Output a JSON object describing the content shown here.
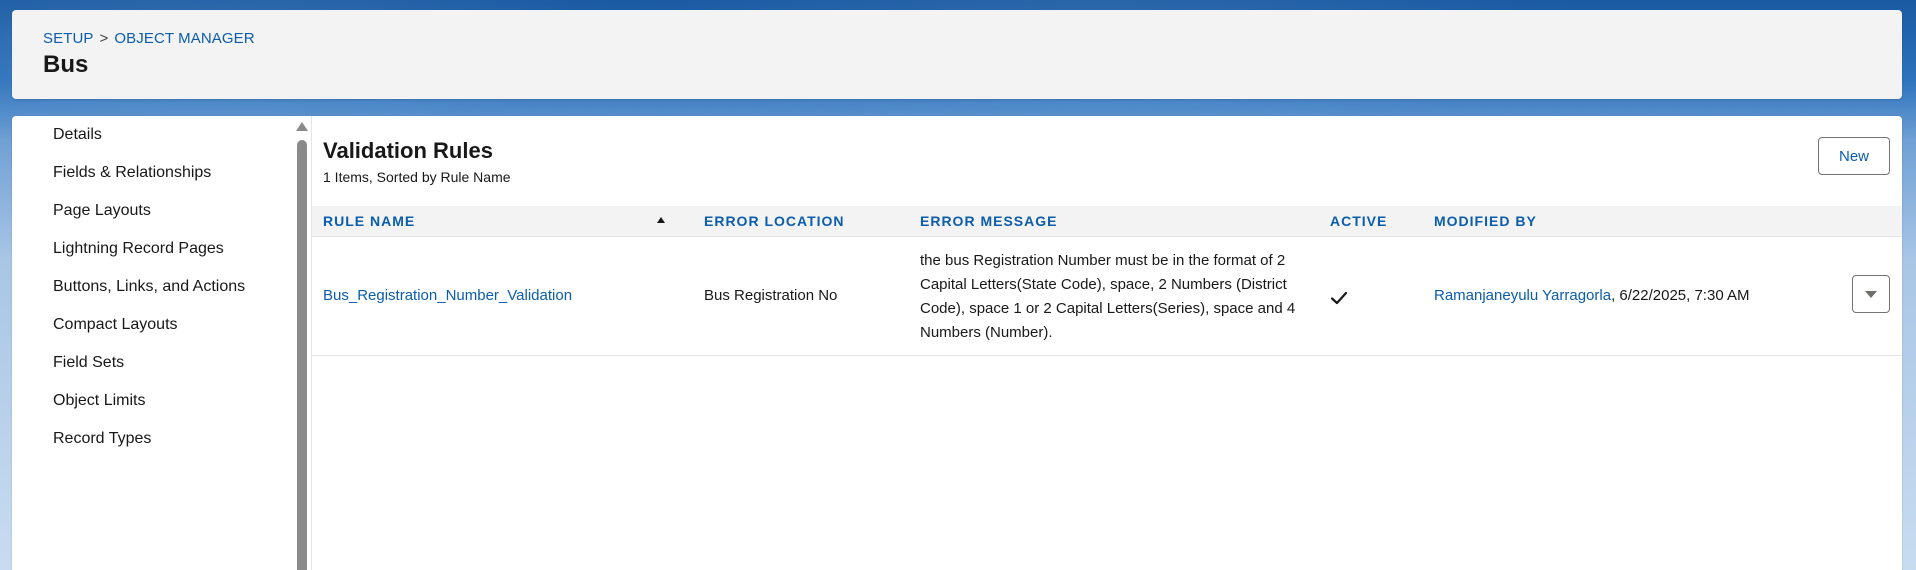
{
  "header": {
    "breadcrumb": {
      "setup": "SETUP",
      "separator": ">",
      "object_manager": "OBJECT MANAGER"
    },
    "title": "Bus"
  },
  "sidebar": {
    "items": [
      {
        "label": "Details"
      },
      {
        "label": "Fields & Relationships"
      },
      {
        "label": "Page Layouts"
      },
      {
        "label": "Lightning Record Pages"
      },
      {
        "label": "Buttons, Links, and Actions"
      },
      {
        "label": "Compact Layouts"
      },
      {
        "label": "Field Sets"
      },
      {
        "label": "Object Limits"
      },
      {
        "label": "Record Types"
      }
    ]
  },
  "main": {
    "title": "Validation Rules",
    "subtitle": "1 Items, Sorted by Rule Name",
    "new_button_label": "New",
    "table": {
      "columns": {
        "rule_name": "RULE NAME",
        "error_location": "ERROR LOCATION",
        "error_message": "ERROR MESSAGE",
        "active": "ACTIVE",
        "modified_by": "MODIFIED BY"
      },
      "sort_column": "rule_name",
      "sort_direction": "ascending",
      "rows": [
        {
          "rule_name": "Bus_Registration_Number_Validation",
          "error_location": "Bus Registration No",
          "error_message": "the bus Registration Number must be in the format of 2 Capital Letters(State Code), space, 2 Numbers (District Code), space 1 or 2 Capital Letters(Series), space and 4 Numbers (Number).",
          "active": true,
          "modified_by_user": "Ramanjaneyulu Yarragorla",
          "modified_by_date": ", 6/22/2025, 7:30 AM"
        }
      ]
    }
  },
  "colors": {
    "link": "#0b5cab",
    "header_bg": "#f3f3f3",
    "text": "#181818"
  }
}
